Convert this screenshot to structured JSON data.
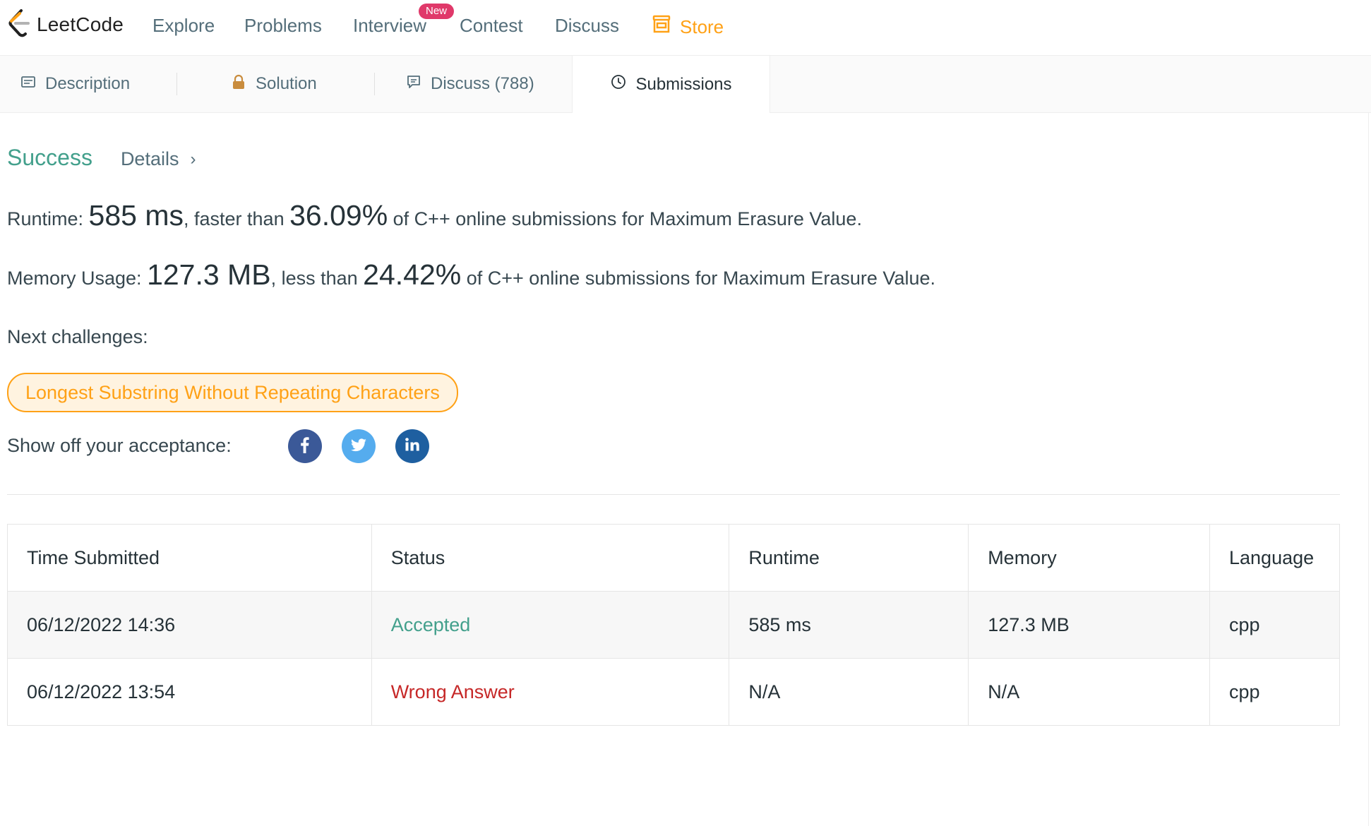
{
  "brand": {
    "name": "LeetCode"
  },
  "nav": {
    "explore": "Explore",
    "problems": "Problems",
    "interview": "Interview",
    "interview_badge": "New",
    "contest": "Contest",
    "discuss": "Discuss",
    "store": "Store"
  },
  "tabs": {
    "description": "Description",
    "solution": "Solution",
    "discuss": "Discuss (788)",
    "submissions": "Submissions"
  },
  "result": {
    "status": "Success",
    "details_label": "Details",
    "runtime": {
      "label": "Runtime: ",
      "value": "585 ms",
      "mid": ", faster than ",
      "percent": "36.09%",
      "suffix": " of C++ online submissions for Maximum Erasure Value."
    },
    "memory": {
      "label": "Memory Usage: ",
      "value": "127.3 MB",
      "mid": ", less than ",
      "percent": "24.42%",
      "suffix": " of C++ online submissions for Maximum Erasure Value."
    },
    "next_label": "Next challenges:",
    "next_challenge": "Longest Substring Without Repeating Characters",
    "share_label": "Show off your acceptance:"
  },
  "table": {
    "headers": [
      "Time Submitted",
      "Status",
      "Runtime",
      "Memory",
      "Language"
    ],
    "rows": [
      {
        "time": "06/12/2022 14:36",
        "status": "Accepted",
        "runtime": "585 ms",
        "memory": "127.3 MB",
        "language": "cpp"
      },
      {
        "time": "06/12/2022 13:54",
        "status": "Wrong Answer",
        "runtime": "N/A",
        "memory": "N/A",
        "language": "cpp"
      }
    ]
  },
  "colors": {
    "accent": "#ffa116",
    "success": "#43a08c",
    "error": "#c62828",
    "badge": "#e0396a"
  },
  "icons": {
    "logo": "leetcode-logo-icon",
    "store": "store-icon",
    "description": "description-icon",
    "solution": "lock-icon",
    "discuss": "comment-icon",
    "submissions": "clock-icon",
    "details": "chevron-right-icon",
    "share": [
      "facebook-icon",
      "twitter-icon",
      "linkedin-icon"
    ]
  }
}
